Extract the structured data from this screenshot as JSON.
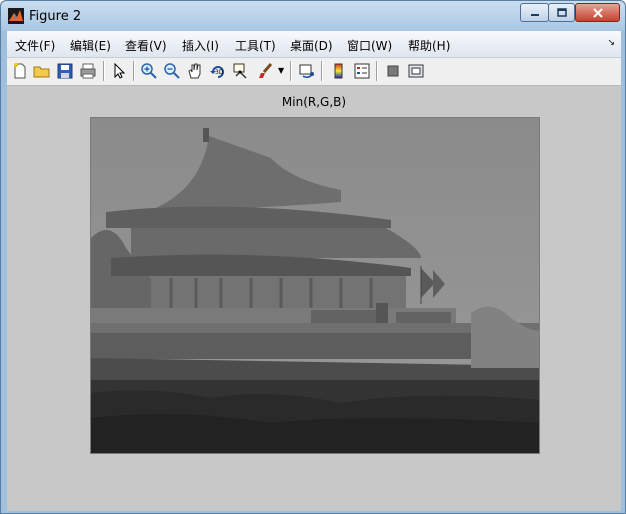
{
  "window": {
    "title": "Figure 2"
  },
  "menu": {
    "items": [
      "文件(F)",
      "编辑(E)",
      "查看(V)",
      "插入(I)",
      "工具(T)",
      "桌面(D)",
      "窗口(W)",
      "帮助(H)"
    ]
  },
  "toolbar": {
    "tools": [
      "new-figure-icon",
      "open-file-icon",
      "save-icon",
      "print-icon",
      "pointer-icon",
      "zoom-in-icon",
      "zoom-out-icon",
      "pan-hand-icon",
      "rotate-3d-icon",
      "data-cursor-icon",
      "brush-icon",
      "link-plot-icon",
      "colorbar-icon",
      "legend-icon",
      "hide-plot-tools-icon",
      "show-plot-tools-icon"
    ]
  },
  "axes": {
    "title": "Min(R,G,B)"
  },
  "image": {
    "description_colormap": "grayscale"
  }
}
